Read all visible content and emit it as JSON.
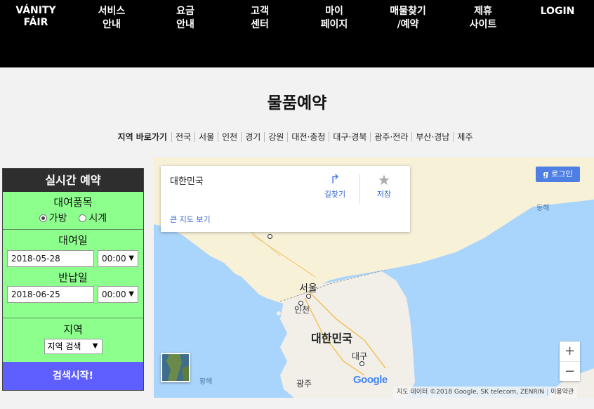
{
  "nav": {
    "logo_line1": "VÁNITY",
    "logo_line2": "FÁIR",
    "items": [
      {
        "l1": "서비스",
        "l2": "안내"
      },
      {
        "l1": "요금",
        "l2": "안내"
      },
      {
        "l1": "고객",
        "l2": "센터"
      },
      {
        "l1": "마이",
        "l2": "페이지"
      },
      {
        "l1": "매물찾기",
        "l2": "/예약"
      },
      {
        "l1": "제휴",
        "l2": "사이트"
      },
      {
        "l1": "LOGIN",
        "l2": ""
      }
    ]
  },
  "page_title": "물품예약",
  "region_bar": {
    "label": "지역 바로가기",
    "items": [
      "전국",
      "서울",
      "인천",
      "경기",
      "강원",
      "대전·충청",
      "대구·경북",
      "광주·전라",
      "부산·경남",
      "제주"
    ]
  },
  "panel": {
    "title": "실시간 예약",
    "item_label": "대여품목",
    "options": [
      "가방",
      "시계"
    ],
    "selected_option": "가방",
    "rent_label": "대여일",
    "rent_date": "2018-05-28",
    "rent_time": "00:00",
    "return_label": "반납일",
    "return_date": "2018-06-25",
    "return_time": "00:00",
    "region_label": "지역",
    "region_select": "지역 검색",
    "search_button": "검색시작!"
  },
  "map": {
    "card_place": "대한민국",
    "card_directions": "길찾기",
    "card_save": "저장",
    "card_bigmap": "큰 지도 보기",
    "login_chip": "로그인",
    "labels": {
      "seoul": "서울",
      "incheon": "인천",
      "korea": "대한민국",
      "daegu": "대구",
      "gwangju": "광주",
      "east_sea": "동해",
      "yellow_sea": "황해"
    },
    "zoom_in": "+",
    "zoom_out": "−",
    "google": "Google",
    "attribution": "지도 데이터 ©2018 Google, SK telecom, ZENRIN",
    "terms": "이용약관",
    "colors": {
      "water": "#a9d4fb",
      "land": "#f2efe9",
      "north_land": "#f7f1d8"
    }
  },
  "colors": {
    "panel_bg": "#8cff8c",
    "panel_head": "#2e2e2e",
    "search_button": "#5f5fff",
    "nav_bg": "#000000"
  }
}
